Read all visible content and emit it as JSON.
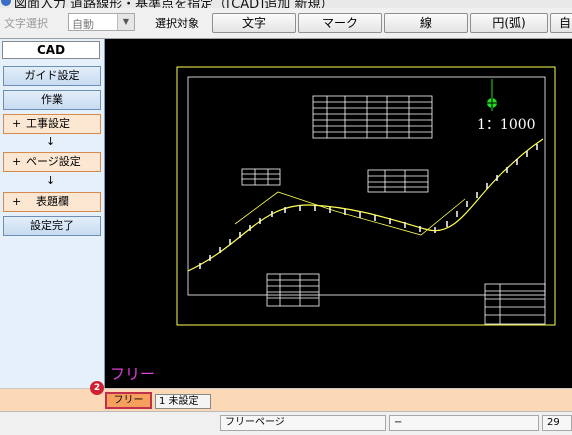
{
  "window": {
    "title": "図面入力 道路線形・基準点を指定（[CAD]追加 新規）"
  },
  "toolbar": {
    "char_select_label": "文字選択",
    "mode_value": "自動",
    "target_label": "選択対象",
    "buttons": [
      "文字",
      "マーク",
      "線",
      "円(弧)",
      "自"
    ]
  },
  "sidebar": {
    "header": "CAD",
    "items": [
      {
        "label": "ガイド設定",
        "kind": "blue"
      },
      {
        "label": "作業",
        "kind": "blue"
      },
      {
        "label": "工事設定",
        "prefix": "+",
        "kind": "orange"
      },
      {
        "label": "ページ設定",
        "prefix": "+",
        "kind": "orange"
      },
      {
        "label": "表題欄",
        "prefix": "+",
        "kind": "orange"
      },
      {
        "label": "設定完了",
        "kind": "blue"
      }
    ],
    "arrow": "↓"
  },
  "canvas": {
    "mode_overlay": "フリー",
    "scale_label": "1：1000"
  },
  "tabs": [
    {
      "label": "フリー",
      "active": true
    },
    {
      "label": "1 未設定",
      "active": false
    }
  ],
  "callout_number": "2",
  "status": {
    "cells": [
      "フリーページ",
      "−",
      "29"
    ]
  },
  "colors": {
    "canvas_background": "#000000",
    "drawing_frame": "#ffff55",
    "road_line": "#ffff55",
    "mode_overlay": "#e040e0",
    "active_tab": "#f5a05c",
    "callout": "#d01f30"
  }
}
